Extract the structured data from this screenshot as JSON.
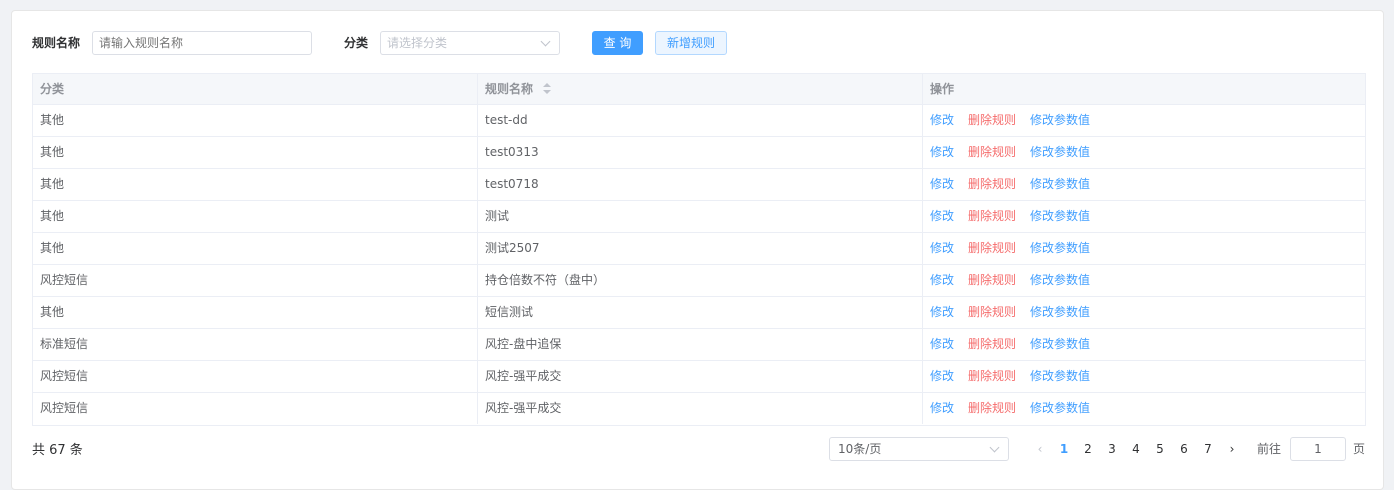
{
  "filters": {
    "rule_name_label": "规则名称",
    "rule_name_placeholder": "请输入规则名称",
    "category_label": "分类",
    "category_placeholder": "请选择分类",
    "query_button": "查 询",
    "add_button": "新增规则"
  },
  "table": {
    "headers": {
      "category": "分类",
      "rule_name": "规则名称",
      "actions": "操作"
    },
    "action_labels": {
      "edit": "修改",
      "delete": "删除规则",
      "edit_params": "修改参数值"
    },
    "rows": [
      {
        "category": "其他",
        "rule_name": "test-dd"
      },
      {
        "category": "其他",
        "rule_name": "test0313"
      },
      {
        "category": "其他",
        "rule_name": "test0718"
      },
      {
        "category": "其他",
        "rule_name": "测试"
      },
      {
        "category": "其他",
        "rule_name": "测试2507"
      },
      {
        "category": "风控短信",
        "rule_name": "持仓倍数不符（盘中）"
      },
      {
        "category": "其他",
        "rule_name": "短信测试"
      },
      {
        "category": "标准短信",
        "rule_name": "风控-盘中追保"
      },
      {
        "category": "风控短信",
        "rule_name": "风控-强平成交"
      },
      {
        "category": "风控短信",
        "rule_name": "风控-强平成交"
      }
    ]
  },
  "pagination": {
    "total_text": "共 67 条",
    "page_size": "10条/页",
    "pages": [
      "1",
      "2",
      "3",
      "4",
      "5",
      "6",
      "7"
    ],
    "current_page": "1",
    "goto_label": "前往",
    "goto_value": "1",
    "page_unit": "页"
  },
  "colors": {
    "primary": "#409eff",
    "danger": "#f56c6c"
  }
}
